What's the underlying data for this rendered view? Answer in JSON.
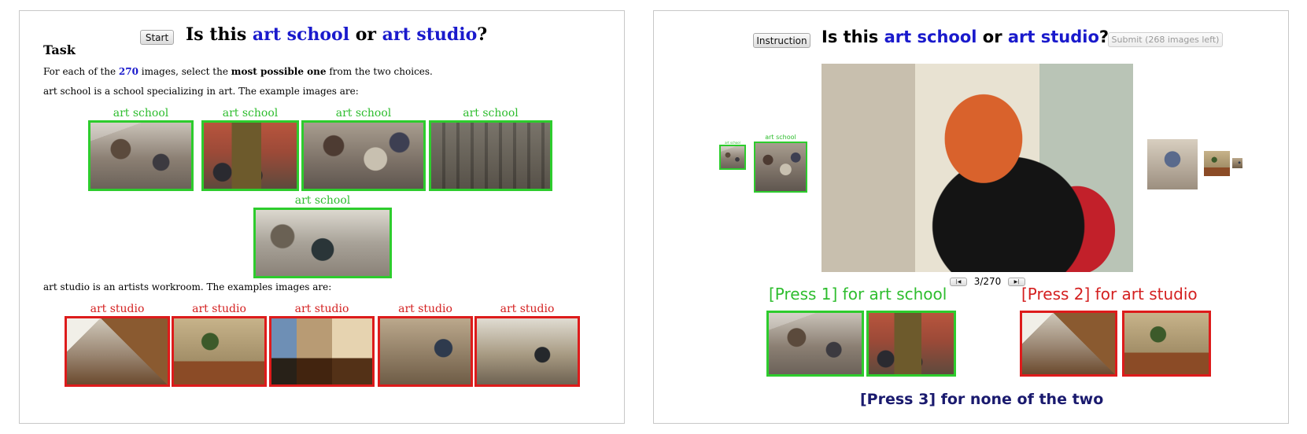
{
  "left": {
    "start_button": "Start",
    "title": {
      "prefix": "Is this ",
      "class_a": "art school",
      "mid": " or ",
      "class_b": "art studio",
      "suffix": "?"
    },
    "task_heading": "Task",
    "instruction": {
      "pre": "For each of the ",
      "count": "270",
      "mid": " images, select the ",
      "bold": "most possible one",
      "post": " from the two choices."
    },
    "class_a_description": "art school is a school specializing in art. The example images are:",
    "class_b_description": "art studio is an artists workroom. The examples images are:",
    "class_a_examples": [
      "art school",
      "art school",
      "art school",
      "art school",
      "art school"
    ],
    "class_b_examples": [
      "art studio",
      "art studio",
      "art studio",
      "art studio",
      "art studio"
    ]
  },
  "right": {
    "instruction_button": "Instruction",
    "title": {
      "prefix": "Is this ",
      "class_a": "art school",
      "mid": " or ",
      "class_b": "art studio",
      "suffix": "?"
    },
    "submit_button": "Submit (268 images left)",
    "prev_label": "art school",
    "prev_small_label": "art school",
    "counter": "3/270",
    "first_button": "|◀",
    "last_button": "▶|",
    "press1": "[Press 1] for art school",
    "press2": "[Press 2] for art studio",
    "press3": "[Press 3] for none of the two"
  },
  "colors": {
    "class": "#1a1acc",
    "green": "#2dcc2d",
    "red": "#dd1b1b",
    "press3": "#1a1a6e"
  }
}
